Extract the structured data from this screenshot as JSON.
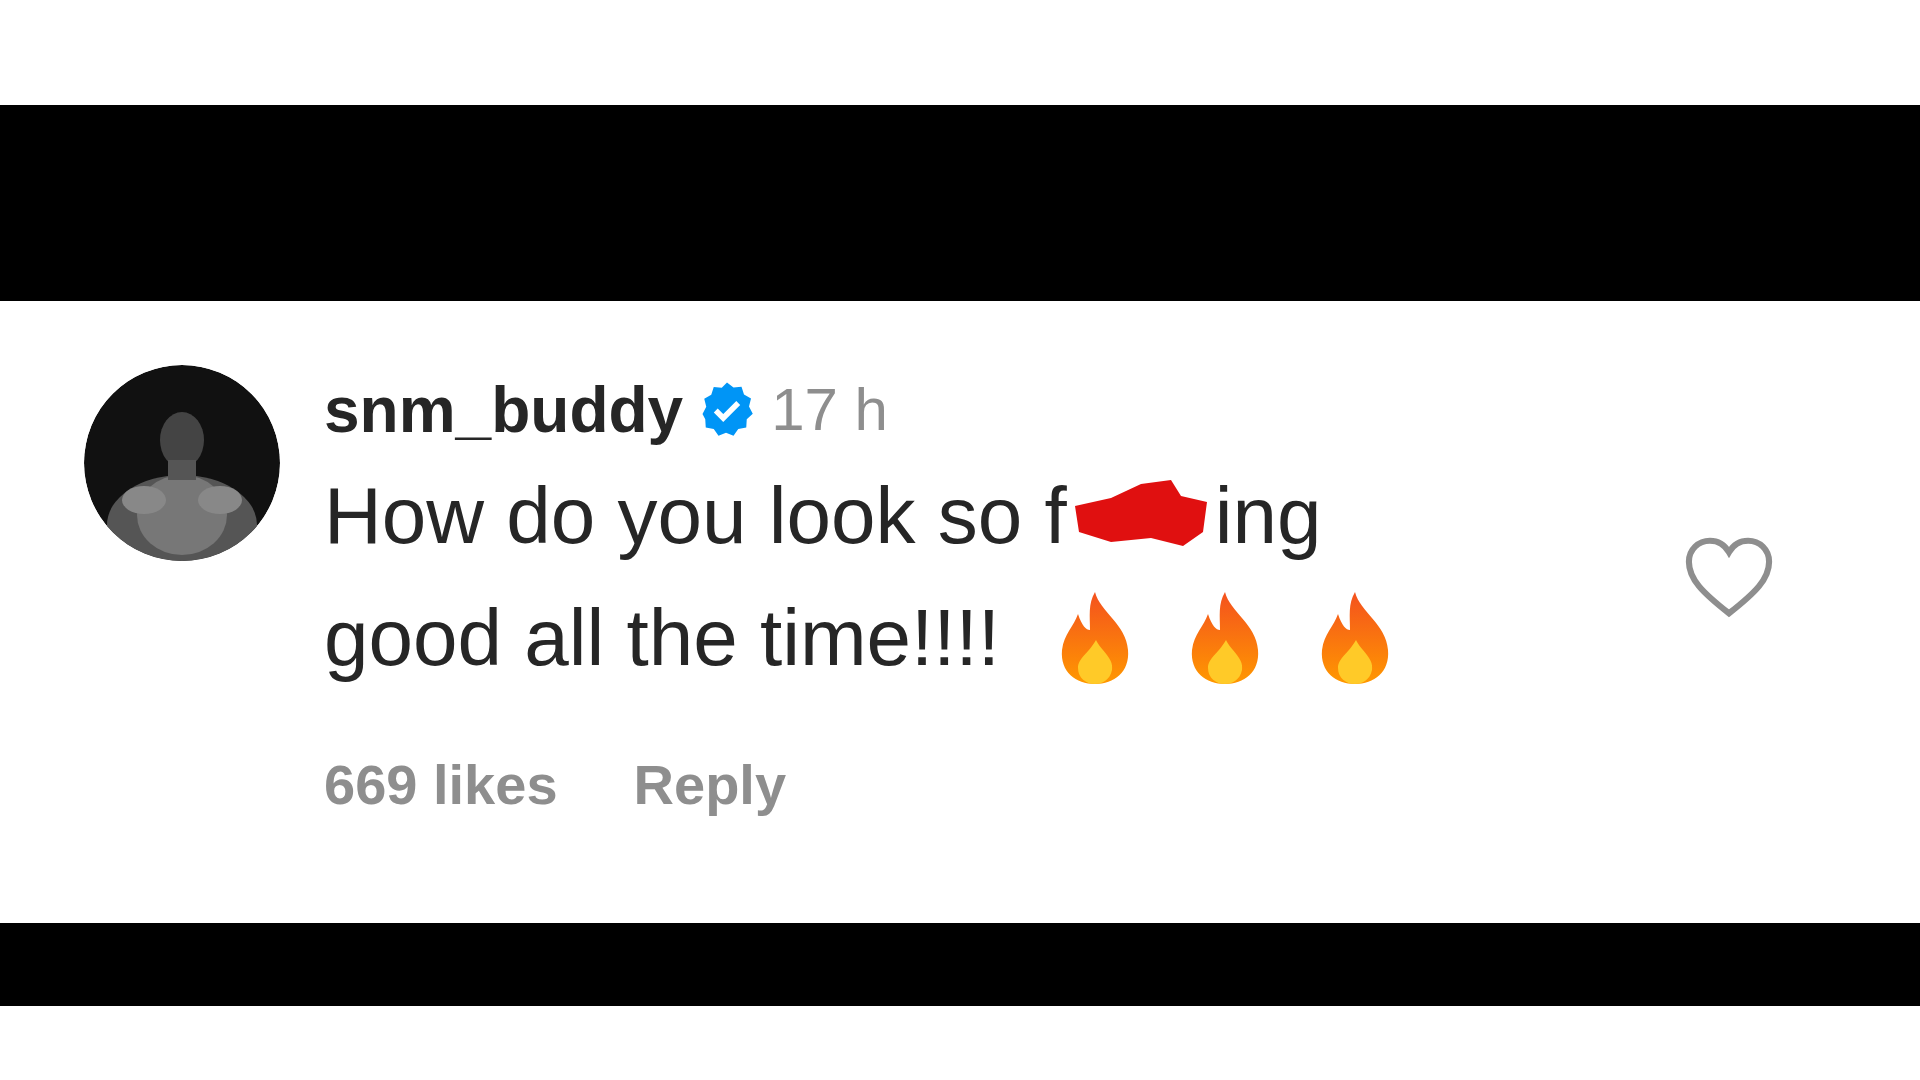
{
  "comment": {
    "username": "snm_buddy",
    "verified": true,
    "time": "17 h",
    "text_start": "How do you look so f",
    "text_after_redaction": "ing",
    "second_line": "good all the time!!!!",
    "likes": "669 likes",
    "reply": "Reply",
    "liked": false
  }
}
